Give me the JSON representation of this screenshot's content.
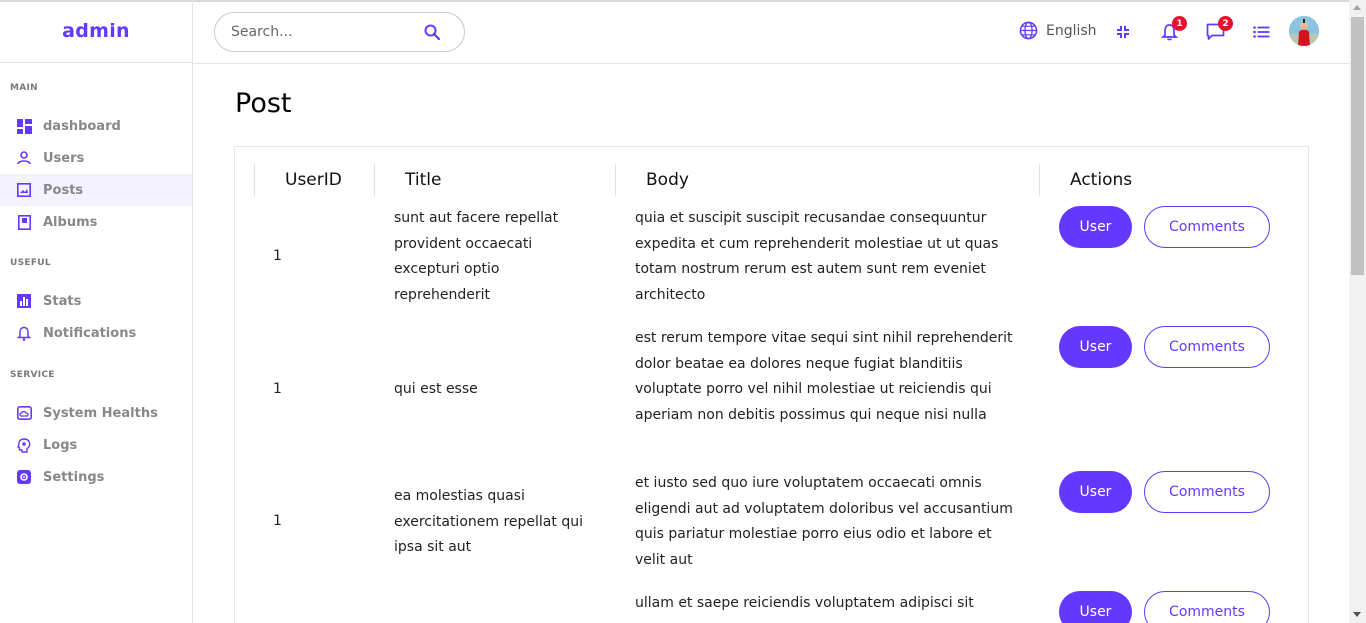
{
  "app": {
    "logo": "admin"
  },
  "sidebar": {
    "sections": [
      {
        "title": "MAIN",
        "items": [
          {
            "label": "dashboard",
            "icon": "dashboard-icon",
            "active": false
          },
          {
            "label": "Users",
            "icon": "user-icon",
            "active": false
          },
          {
            "label": "Posts",
            "icon": "image-icon",
            "active": true
          },
          {
            "label": "Albums",
            "icon": "album-icon",
            "active": false
          }
        ]
      },
      {
        "title": "USEFUL",
        "items": [
          {
            "label": "Stats",
            "icon": "bar-chart-icon",
            "active": false
          },
          {
            "label": "Notifications",
            "icon": "bell-icon",
            "active": false
          }
        ]
      },
      {
        "title": "SERVICE",
        "items": [
          {
            "label": "System Healths",
            "icon": "cloud-icon",
            "active": false
          },
          {
            "label": "Logs",
            "icon": "brain-icon",
            "active": false
          },
          {
            "label": "Settings",
            "icon": "settings-icon",
            "active": false
          }
        ]
      }
    ]
  },
  "topbar": {
    "search_placeholder": "Search...",
    "language": "English",
    "notifications_count": "1",
    "messages_count": "2"
  },
  "page": {
    "title": "Post"
  },
  "table": {
    "headers": [
      "UserID",
      "Title",
      "Body",
      "Actions"
    ],
    "user_button": "User",
    "comments_button": "Comments",
    "rows": [
      {
        "userId": "1",
        "title": "sunt aut facere repellat provident occaecati excepturi optio reprehenderit",
        "body": "quia et suscipit suscipit recusandae consequuntur expedita et cum reprehenderit molestiae ut ut quas totam nostrum rerum est autem sunt rem eveniet architecto"
      },
      {
        "userId": "1",
        "title": "qui est esse",
        "body": "est rerum tempore vitae sequi sint nihil reprehenderit dolor beatae ea dolores neque fugiat blanditiis voluptate porro vel nihil molestiae ut reiciendis qui aperiam non debitis possimus qui neque nisi nulla"
      },
      {
        "userId": "1",
        "title": "ea molestias quasi exercitationem repellat qui ipsa sit aut",
        "body": "et iusto sed quo iure voluptatem occaecati omnis eligendi aut ad voluptatem doloribus vel accusantium quis pariatur molestiae porro eius odio et labore et velit aut"
      },
      {
        "userId": "",
        "title": "",
        "body": "ullam et saepe reiciendis voluptatem adipisci sit"
      }
    ]
  },
  "colors": {
    "accent": "#6439ff",
    "badge": "#e8112d",
    "icon_purple": "#6439ff"
  }
}
